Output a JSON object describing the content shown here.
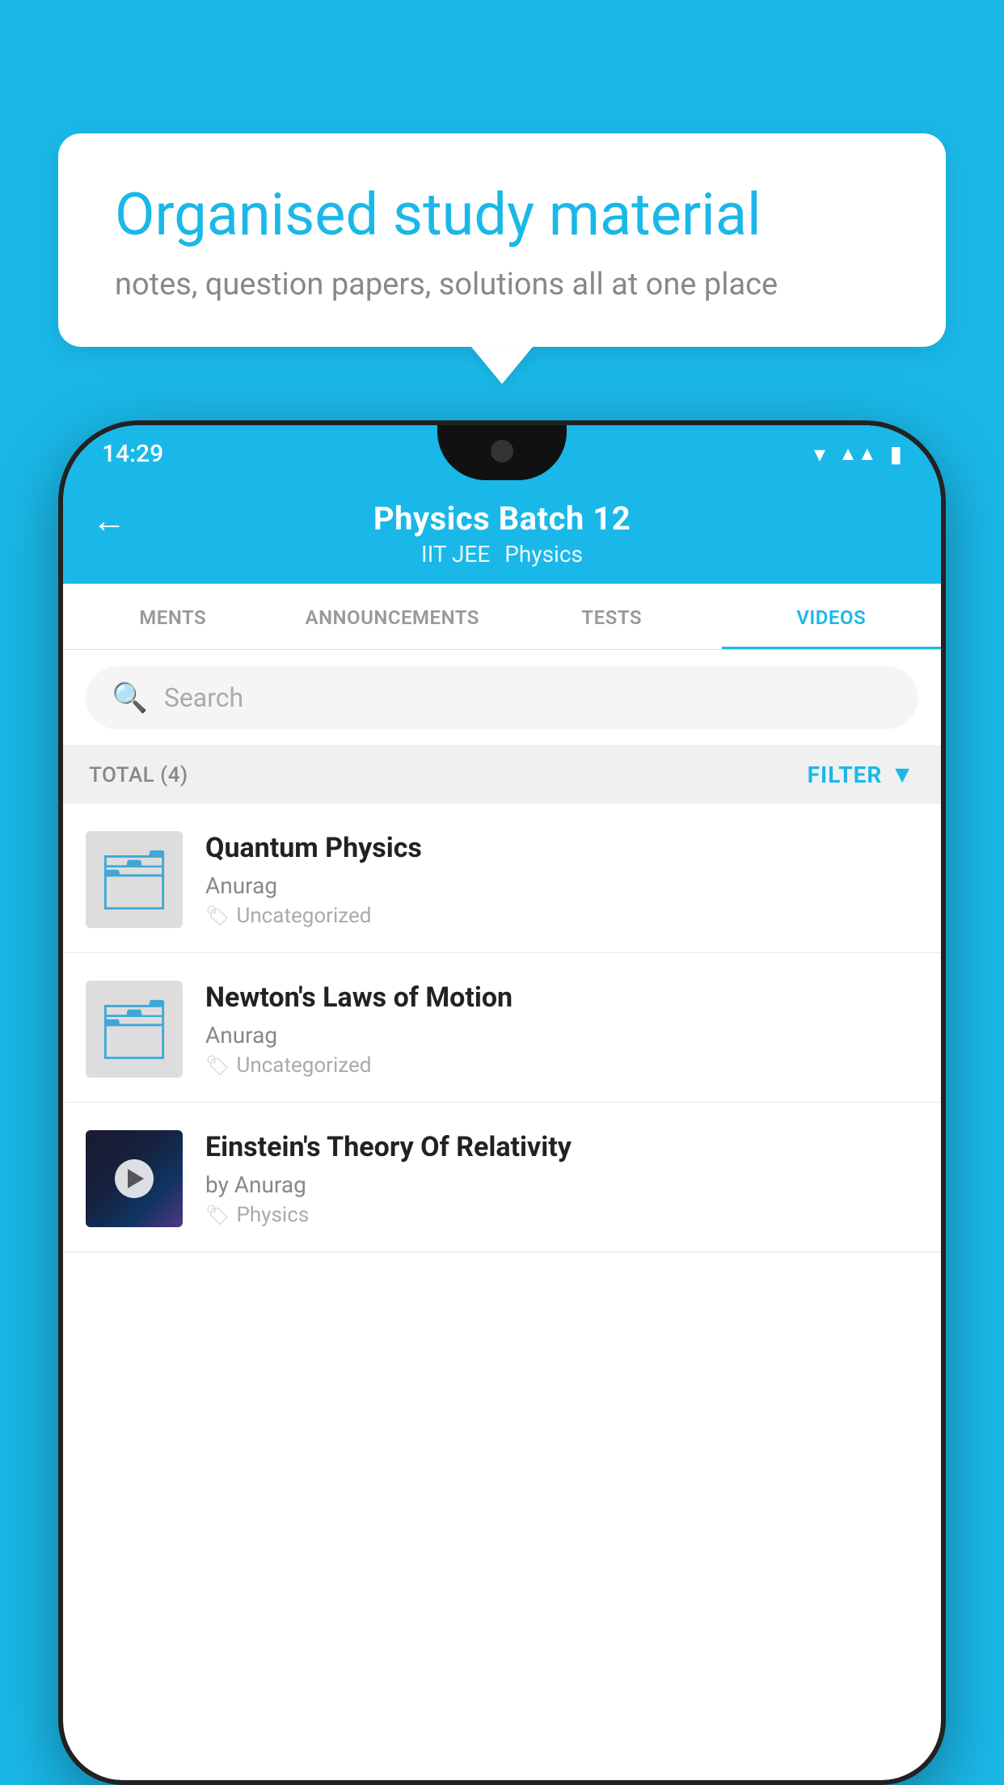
{
  "background_color": "#1ab8e8",
  "bubble": {
    "title": "Organised study material",
    "subtitle": "notes, question papers, solutions all at one place"
  },
  "phone": {
    "status_bar": {
      "time": "14:29",
      "icons": [
        "wifi",
        "signal",
        "battery"
      ]
    },
    "header": {
      "back_label": "←",
      "title": "Physics Batch 12",
      "subtitle_left": "IIT JEE",
      "subtitle_right": "Physics"
    },
    "tabs": [
      {
        "label": "MENTS",
        "active": false
      },
      {
        "label": "ANNOUNCEMENTS",
        "active": false
      },
      {
        "label": "TESTS",
        "active": false
      },
      {
        "label": "VIDEOS",
        "active": true
      }
    ],
    "search": {
      "placeholder": "Search"
    },
    "filter_row": {
      "total_label": "TOTAL (4)",
      "filter_label": "FILTER"
    },
    "videos": [
      {
        "id": 1,
        "title": "Quantum Physics",
        "author": "Anurag",
        "tag": "Uncategorized",
        "has_thumbnail": false
      },
      {
        "id": 2,
        "title": "Newton's Laws of Motion",
        "author": "Anurag",
        "tag": "Uncategorized",
        "has_thumbnail": false
      },
      {
        "id": 3,
        "title": "Einstein's Theory Of Relativity",
        "author": "by Anurag",
        "tag": "Physics",
        "has_thumbnail": true
      }
    ]
  }
}
